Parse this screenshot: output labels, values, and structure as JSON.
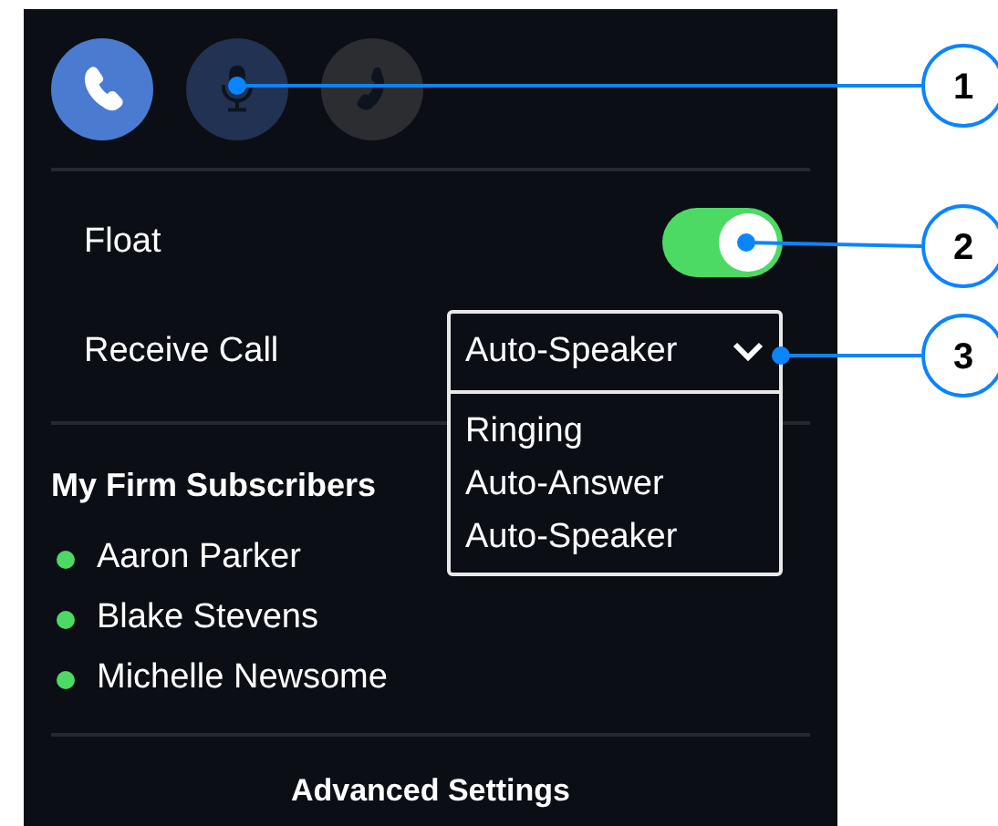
{
  "call_modes": [
    {
      "kind": "phone",
      "selected": true,
      "disabled": false
    },
    {
      "kind": "mic",
      "selected": false,
      "disabled": false
    },
    {
      "kind": "handset",
      "selected": false,
      "disabled": true
    }
  ],
  "float": {
    "label": "Float",
    "on": true
  },
  "receive_call": {
    "label": "Receive Call",
    "value": "Auto-Speaker",
    "expanded": true,
    "options": [
      "Ringing",
      "Auto-Answer",
      "Auto-Speaker"
    ]
  },
  "subscribers": {
    "title": "My Firm Subscribers",
    "items": [
      {
        "name": "Aaron Parker",
        "online": true
      },
      {
        "name": "Blake Stevens",
        "online": true
      },
      {
        "name": "Michelle Newsome",
        "online": true
      }
    ]
  },
  "footer_link": "Advanced Settings",
  "callouts": [
    "1",
    "2",
    "3"
  ]
}
